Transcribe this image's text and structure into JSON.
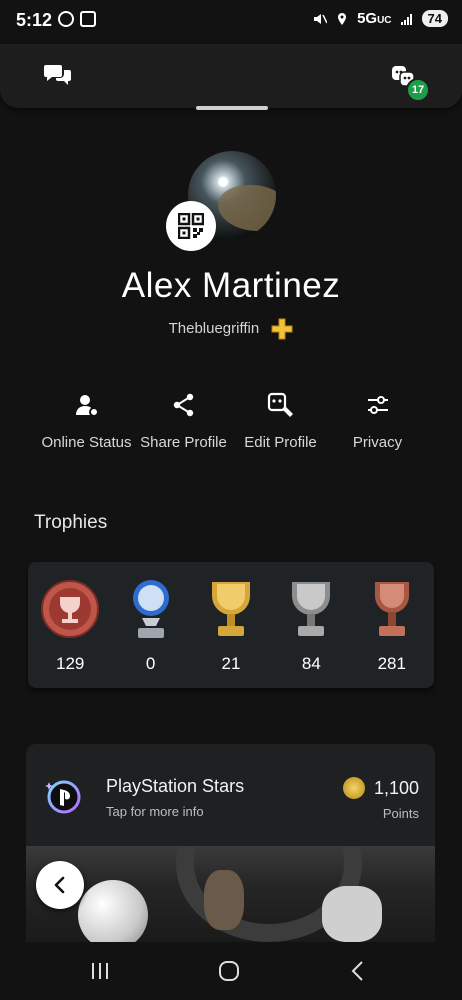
{
  "status_bar": {
    "time": "5:12",
    "network": "5G",
    "network_sub": "UC",
    "battery": "74"
  },
  "top_sheet": {
    "friends_badge": "17"
  },
  "profile": {
    "name": "Alex Martinez",
    "online_id": "Thebluegriffin"
  },
  "actions": [
    {
      "label": "Online Status",
      "icon": "online-status-icon"
    },
    {
      "label": "Share Profile",
      "icon": "share-icon"
    },
    {
      "label": "Edit Profile",
      "icon": "edit-profile-icon"
    },
    {
      "label": "Privacy",
      "icon": "privacy-sliders-icon"
    }
  ],
  "trophies": {
    "title": "Trophies",
    "items": [
      {
        "type": "level",
        "count": "129",
        "color": "#c0554a"
      },
      {
        "type": "platinum",
        "count": "0",
        "color": "#9fb7d8"
      },
      {
        "type": "gold",
        "count": "21",
        "color": "#d5a63a"
      },
      {
        "type": "silver",
        "count": "84",
        "color": "#a9a9a9"
      },
      {
        "type": "bronze",
        "count": "281",
        "color": "#c2705a"
      }
    ]
  },
  "stars": {
    "title": "PlayStation Stars",
    "subtitle": "Tap for more info",
    "points": "1,100",
    "points_label": "Points"
  },
  "colors": {
    "background": "#121212",
    "card": "#202325",
    "badge_green": "#1f9e4a",
    "ps_plus_gold": "#f2c23a"
  }
}
